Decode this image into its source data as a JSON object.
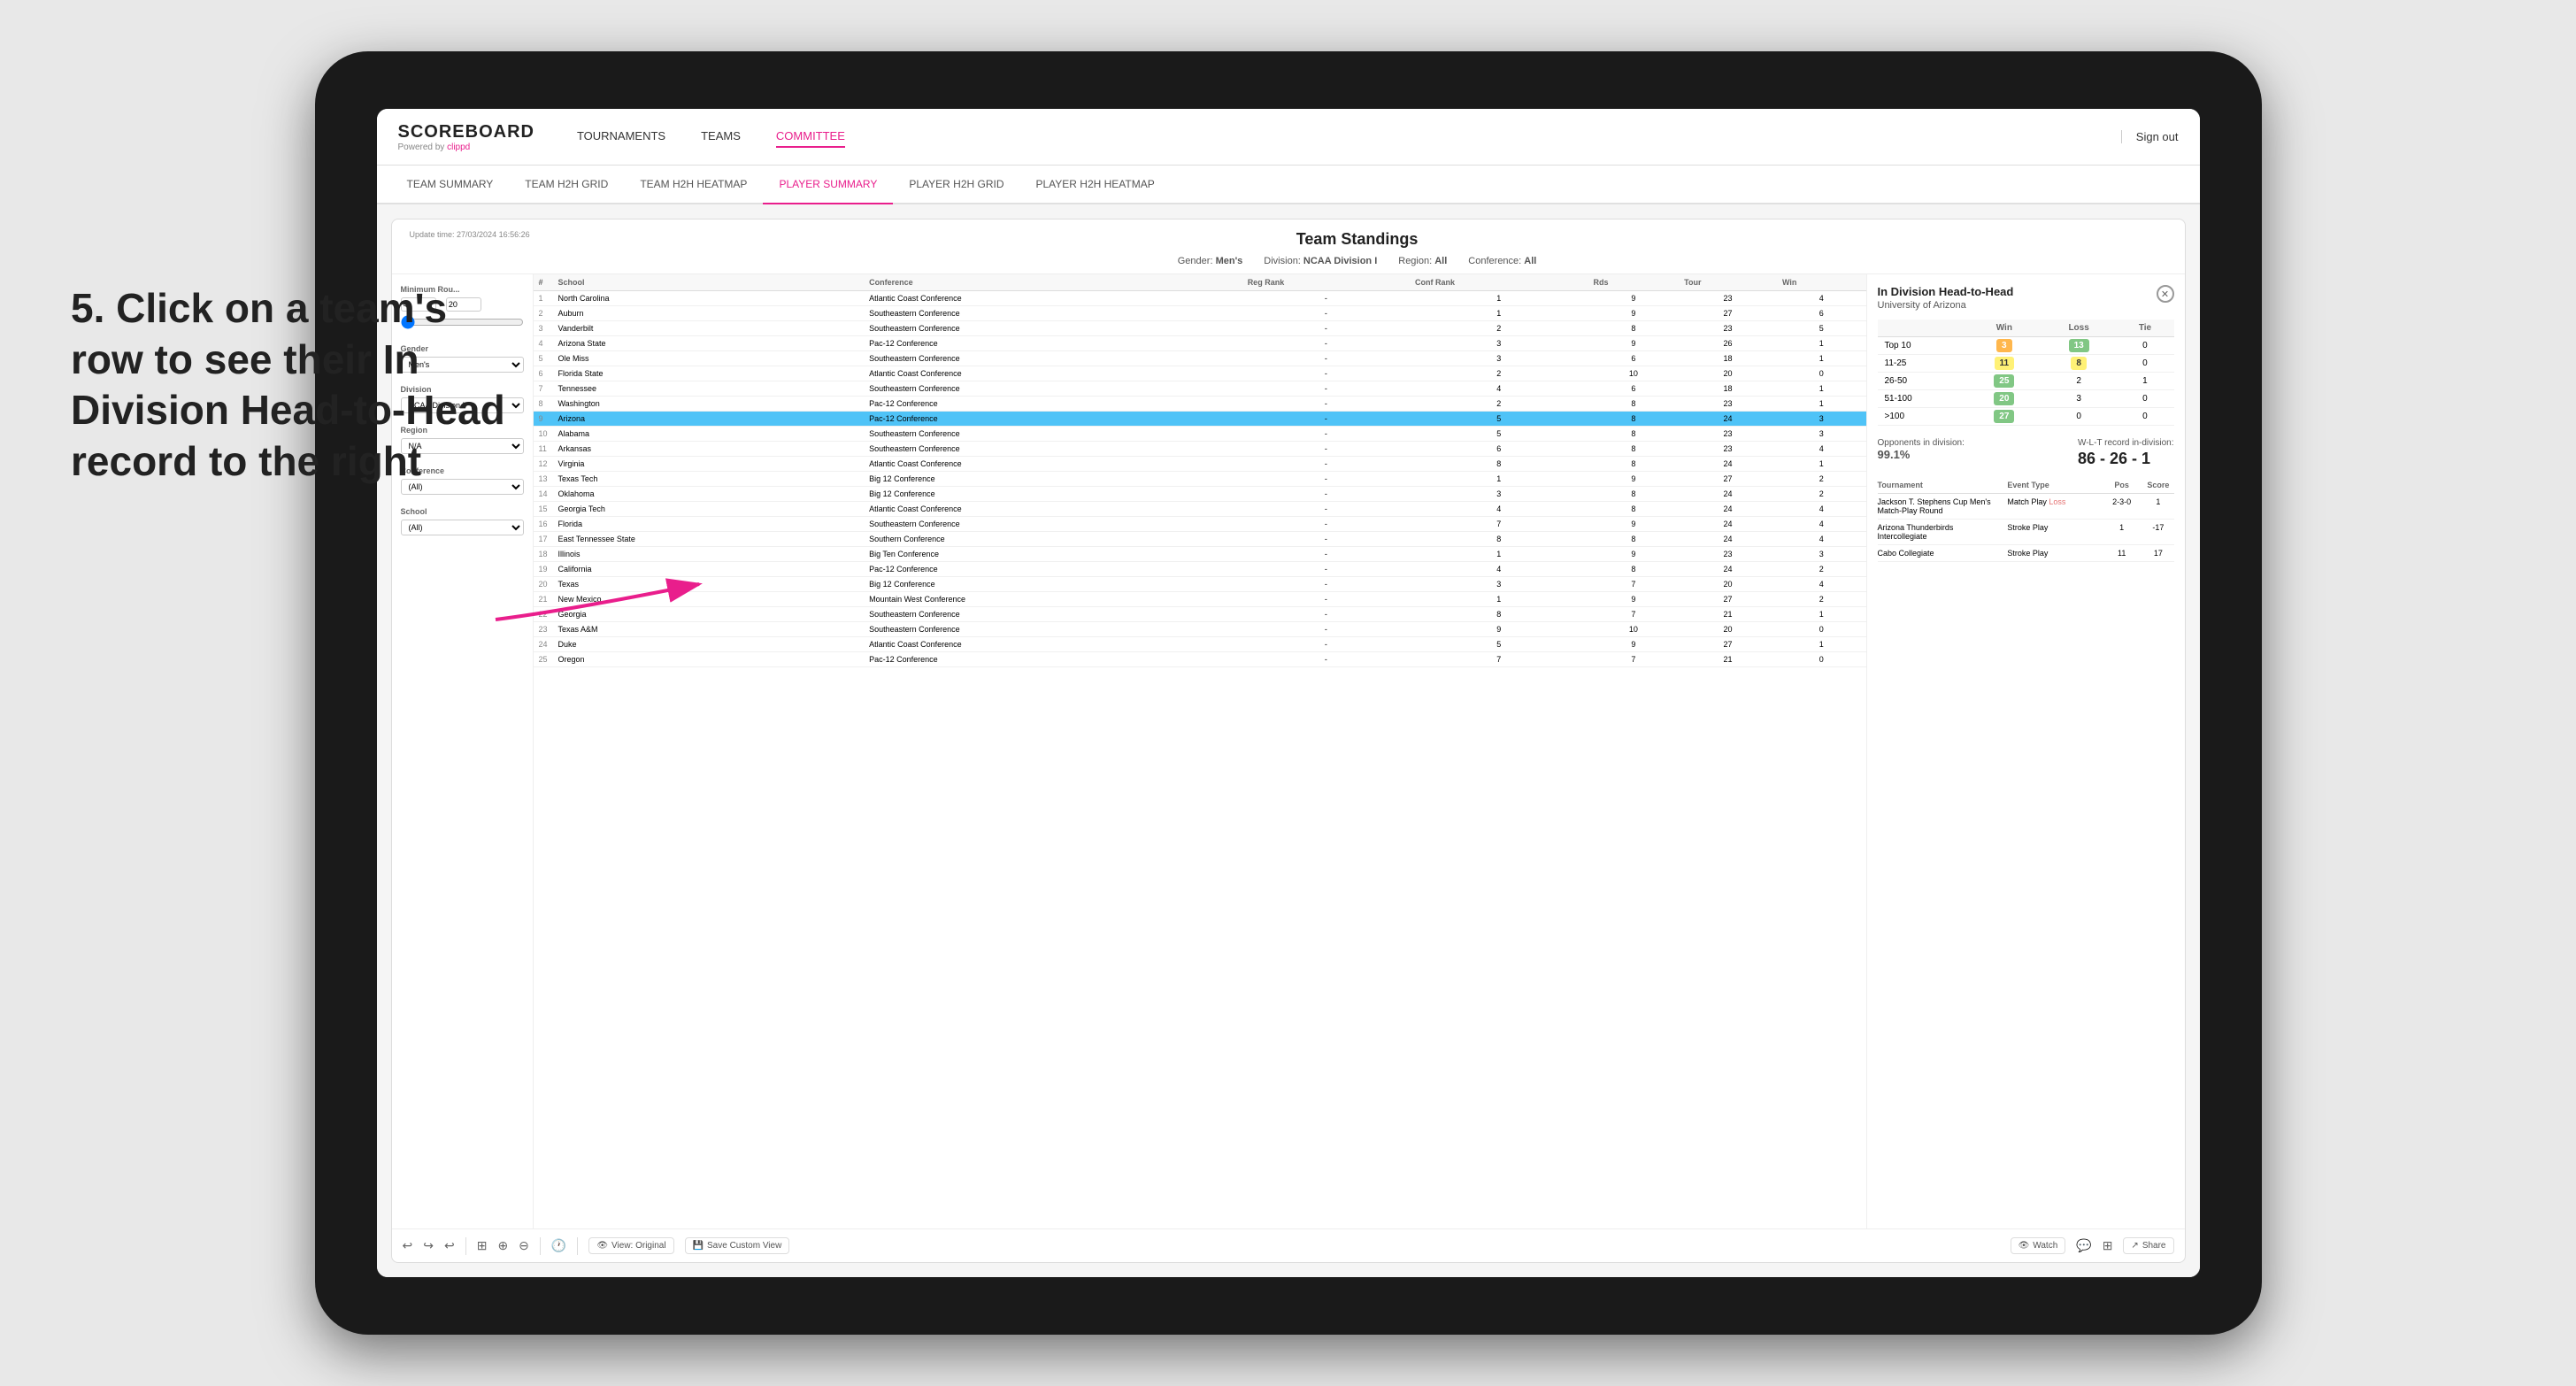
{
  "annotation": {
    "text": "5. Click on a team's row to see their In Division Head-to-Head record to the right"
  },
  "top_nav": {
    "logo": "SCOREBOARD",
    "logo_sub": "Powered by clippd",
    "nav_items": [
      "TOURNAMENTS",
      "TEAMS",
      "COMMITTEE"
    ],
    "sign_out": "Sign out"
  },
  "sub_nav": {
    "items": [
      "TEAM SUMMARY",
      "TEAM H2H GRID",
      "TEAM H2H HEATMAP",
      "PLAYER SUMMARY",
      "PLAYER H2H GRID",
      "PLAYER H2H HEATMAP"
    ],
    "active": "PLAYER SUMMARY"
  },
  "scoreboard": {
    "update_time": "Update time: 27/03/2024 16:56:26",
    "title": "Team Standings",
    "filters": {
      "gender": "Men's",
      "division": "NCAA Division I",
      "region": "All",
      "conference": "All"
    },
    "left_filters": {
      "minimum_rounds_label": "Minimum Rou...",
      "minimum_rounds_value": "4",
      "minimum_rounds_max": "20",
      "gender_label": "Gender",
      "gender_value": "Men's",
      "division_label": "Division",
      "division_value": "NCAA Division I",
      "region_label": "Region",
      "region_value": "N/A",
      "conference_label": "Conference",
      "conference_value": "(All)",
      "school_label": "School",
      "school_value": "(All)"
    },
    "table_headers": [
      "#",
      "School",
      "Conference",
      "Reg Rank",
      "Conf Rank",
      "Rds",
      "Tour",
      "Win"
    ],
    "teams": [
      {
        "rank": 1,
        "school": "North Carolina",
        "conference": "Atlantic Coast Conference",
        "reg_rank": "-",
        "conf_rank": 1,
        "rds": 9,
        "tour": 23,
        "win": 4
      },
      {
        "rank": 2,
        "school": "Auburn",
        "conference": "Southeastern Conference",
        "reg_rank": "-",
        "conf_rank": 1,
        "rds": 9,
        "tour": 27,
        "win": 6
      },
      {
        "rank": 3,
        "school": "Vanderbilt",
        "conference": "Southeastern Conference",
        "reg_rank": "-",
        "conf_rank": 2,
        "rds": 8,
        "tour": 23,
        "win": 5
      },
      {
        "rank": 4,
        "school": "Arizona State",
        "conference": "Pac-12 Conference",
        "reg_rank": "-",
        "conf_rank": 3,
        "rds": 9,
        "tour": 26,
        "win": 1
      },
      {
        "rank": 5,
        "school": "Ole Miss",
        "conference": "Southeastern Conference",
        "reg_rank": "-",
        "conf_rank": 3,
        "rds": 6,
        "tour": 18,
        "win": 1
      },
      {
        "rank": 6,
        "school": "Florida State",
        "conference": "Atlantic Coast Conference",
        "reg_rank": "-",
        "conf_rank": 2,
        "rds": 10,
        "tour": 20,
        "win": 0
      },
      {
        "rank": 7,
        "school": "Tennessee",
        "conference": "Southeastern Conference",
        "reg_rank": "-",
        "conf_rank": 4,
        "rds": 6,
        "tour": 18,
        "win": 1
      },
      {
        "rank": 8,
        "school": "Washington",
        "conference": "Pac-12 Conference",
        "reg_rank": "-",
        "conf_rank": 2,
        "rds": 8,
        "tour": 23,
        "win": 1
      },
      {
        "rank": 9,
        "school": "Arizona",
        "conference": "Pac-12 Conference",
        "reg_rank": "-",
        "conf_rank": 5,
        "rds": 8,
        "tour": 24,
        "win": 3,
        "selected": true
      },
      {
        "rank": 10,
        "school": "Alabama",
        "conference": "Southeastern Conference",
        "reg_rank": "-",
        "conf_rank": 5,
        "rds": 8,
        "tour": 23,
        "win": 3
      },
      {
        "rank": 11,
        "school": "Arkansas",
        "conference": "Southeastern Conference",
        "reg_rank": "-",
        "conf_rank": 6,
        "rds": 8,
        "tour": 23,
        "win": 4
      },
      {
        "rank": 12,
        "school": "Virginia",
        "conference": "Atlantic Coast Conference",
        "reg_rank": "-",
        "conf_rank": 8,
        "rds": 8,
        "tour": 24,
        "win": 1
      },
      {
        "rank": 13,
        "school": "Texas Tech",
        "conference": "Big 12 Conference",
        "reg_rank": "-",
        "conf_rank": 1,
        "rds": 9,
        "tour": 27,
        "win": 2
      },
      {
        "rank": 14,
        "school": "Oklahoma",
        "conference": "Big 12 Conference",
        "reg_rank": "-",
        "conf_rank": 3,
        "rds": 8,
        "tour": 24,
        "win": 2
      },
      {
        "rank": 15,
        "school": "Georgia Tech",
        "conference": "Atlantic Coast Conference",
        "reg_rank": "-",
        "conf_rank": 4,
        "rds": 8,
        "tour": 24,
        "win": 4
      },
      {
        "rank": 16,
        "school": "Florida",
        "conference": "Southeastern Conference",
        "reg_rank": "-",
        "conf_rank": 7,
        "rds": 9,
        "tour": 24,
        "win": 4
      },
      {
        "rank": 17,
        "school": "East Tennessee State",
        "conference": "Southern Conference",
        "reg_rank": "-",
        "conf_rank": 8,
        "rds": 8,
        "tour": 24,
        "win": 4
      },
      {
        "rank": 18,
        "school": "Illinois",
        "conference": "Big Ten Conference",
        "reg_rank": "-",
        "conf_rank": 1,
        "rds": 9,
        "tour": 23,
        "win": 3
      },
      {
        "rank": 19,
        "school": "California",
        "conference": "Pac-12 Conference",
        "reg_rank": "-",
        "conf_rank": 4,
        "rds": 8,
        "tour": 24,
        "win": 2
      },
      {
        "rank": 20,
        "school": "Texas",
        "conference": "Big 12 Conference",
        "reg_rank": "-",
        "conf_rank": 3,
        "rds": 7,
        "tour": 20,
        "win": 4
      },
      {
        "rank": 21,
        "school": "New Mexico",
        "conference": "Mountain West Conference",
        "reg_rank": "-",
        "conf_rank": 1,
        "rds": 9,
        "tour": 27,
        "win": 2
      },
      {
        "rank": 22,
        "school": "Georgia",
        "conference": "Southeastern Conference",
        "reg_rank": "-",
        "conf_rank": 8,
        "rds": 7,
        "tour": 21,
        "win": 1
      },
      {
        "rank": 23,
        "school": "Texas A&M",
        "conference": "Southeastern Conference",
        "reg_rank": "-",
        "conf_rank": 9,
        "rds": 10,
        "tour": 20,
        "win": 0
      },
      {
        "rank": 24,
        "school": "Duke",
        "conference": "Atlantic Coast Conference",
        "reg_rank": "-",
        "conf_rank": 5,
        "rds": 9,
        "tour": 27,
        "win": 1
      },
      {
        "rank": 25,
        "school": "Oregon",
        "conference": "Pac-12 Conference",
        "reg_rank": "-",
        "conf_rank": 7,
        "rds": 7,
        "tour": 21,
        "win": 0
      }
    ],
    "h2h_panel": {
      "title": "In Division Head-to-Head",
      "school": "University of Arizona",
      "table": {
        "headers": [
          "",
          "Win",
          "Loss",
          "Tie"
        ],
        "rows": [
          {
            "range": "Top 10",
            "win": 3,
            "loss": 13,
            "tie": 0,
            "win_class": "cell-orange",
            "loss_class": "cell-green"
          },
          {
            "range": "11-25",
            "win": 11,
            "loss": 8,
            "tie": 0,
            "win_class": "cell-yellow",
            "loss_class": "cell-yellow"
          },
          {
            "range": "26-50",
            "win": 25,
            "loss": 2,
            "tie": 1,
            "win_class": "cell-green",
            "loss_class": "cell-0"
          },
          {
            "range": "51-100",
            "win": 20,
            "loss": 3,
            "tie": 0,
            "win_class": "cell-green",
            "loss_class": "cell-0"
          },
          {
            "range": ">100",
            "win": 27,
            "loss": 0,
            "tie": 0,
            "win_class": "cell-green",
            "loss_class": "cell-0"
          }
        ]
      },
      "opponents_label": "Opponents in division:",
      "opponents_value": "99.1%",
      "wlt_label": "W-L-T record in-division:",
      "wlt_value": "86 - 26 - 1",
      "tournaments": {
        "headers": [
          "Tournament",
          "Event Type",
          "Pos",
          "Score"
        ],
        "rows": [
          {
            "name": "Jackson T. Stephens Cup Men's Match-Play Round",
            "event_type": "Match Play",
            "result": "Loss",
            "pos": "2-3-0",
            "score": "1"
          },
          {
            "name": "Arizona Thunderbirds Intercollegiate",
            "event_type": "Stroke Play",
            "pos": "1",
            "score": "-17"
          },
          {
            "name": "Cabo Collegiate",
            "event_type": "Stroke Play",
            "pos": "11",
            "score": "17"
          }
        ]
      }
    },
    "toolbar": {
      "view_original": "View: Original",
      "save_custom_view": "Save Custom View",
      "watch": "Watch",
      "share": "Share"
    }
  }
}
